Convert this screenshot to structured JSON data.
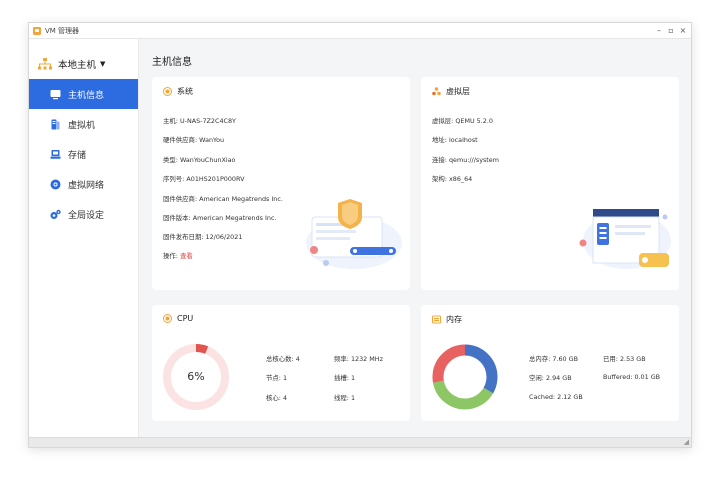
{
  "window": {
    "title": "VM 管理器",
    "controls": [
      "–",
      "▫",
      "×"
    ]
  },
  "sidebar": {
    "host": "本地主机",
    "items": [
      {
        "label": "主机信息",
        "active": true,
        "icon": "monitor-icon"
      },
      {
        "label": "虚拟机",
        "active": false,
        "icon": "server-icon"
      },
      {
        "label": "存储",
        "active": false,
        "icon": "storage-icon"
      },
      {
        "label": "虚拟网络",
        "active": false,
        "icon": "network-icon"
      },
      {
        "label": "全局设定",
        "active": false,
        "icon": "gear-icon"
      }
    ]
  },
  "main": {
    "title": "主机信息"
  },
  "system": {
    "title": "系统",
    "rows": [
      {
        "label": "主机:",
        "value": "U-NAS-7Z2C4C8Y"
      },
      {
        "label": "硬件供应商:",
        "value": "WanYou"
      },
      {
        "label": "类型:",
        "value": "WanYouChunXiao"
      },
      {
        "label": "序列号:",
        "value": "A01HS201P000RV"
      },
      {
        "label": "固件供应商:",
        "value": "American Megatrends Inc."
      },
      {
        "label": "固件版本:",
        "value": "American Megatrends Inc."
      },
      {
        "label": "固件发布日期:",
        "value": "12/06/2021"
      }
    ],
    "action_label": "操作:",
    "action_link": "查看"
  },
  "hypervisor": {
    "title": "虚拟层",
    "rows": [
      {
        "label": "虚拟层:",
        "value": "QEMU 5.2.0"
      },
      {
        "label": "地址:",
        "value": "localhost"
      },
      {
        "label": "连接:",
        "value": "qemu:///system"
      },
      {
        "label": "架构:",
        "value": "x86_64"
      }
    ]
  },
  "cpu": {
    "title": "CPU",
    "usage_label": "6%",
    "usage_fraction": 0.06,
    "stats": [
      {
        "label": "总核心数:",
        "value": "4"
      },
      {
        "label": "频率:",
        "value": "1232 MHz"
      },
      {
        "label": "节点:",
        "value": "1"
      },
      {
        "label": "插槽:",
        "value": "1"
      },
      {
        "label": "核心:",
        "value": "4"
      },
      {
        "label": "线程:",
        "value": "1"
      }
    ]
  },
  "memory": {
    "title": "内存",
    "stats": [
      {
        "label": "总内存:",
        "value": "7.60 GB"
      },
      {
        "label": "已用:",
        "value": "2.53 GB"
      },
      {
        "label": "空闲:",
        "value": "2.94 GB"
      },
      {
        "label": "Buffered:",
        "value": "0.01 GB"
      },
      {
        "label": "Cached:",
        "value": "2.12 GB"
      }
    ],
    "donut": [
      {
        "name": "已用",
        "value": 2.53,
        "color": "#4472c4"
      },
      {
        "name": "空闲",
        "value": 2.94,
        "color": "#8cc665"
      },
      {
        "name": "Cached",
        "value": 2.12,
        "color": "#e86262"
      }
    ]
  },
  "colors": {
    "accent": "#2c6be0",
    "system_icon": "#f3a43a",
    "danger": "#e0413b"
  }
}
